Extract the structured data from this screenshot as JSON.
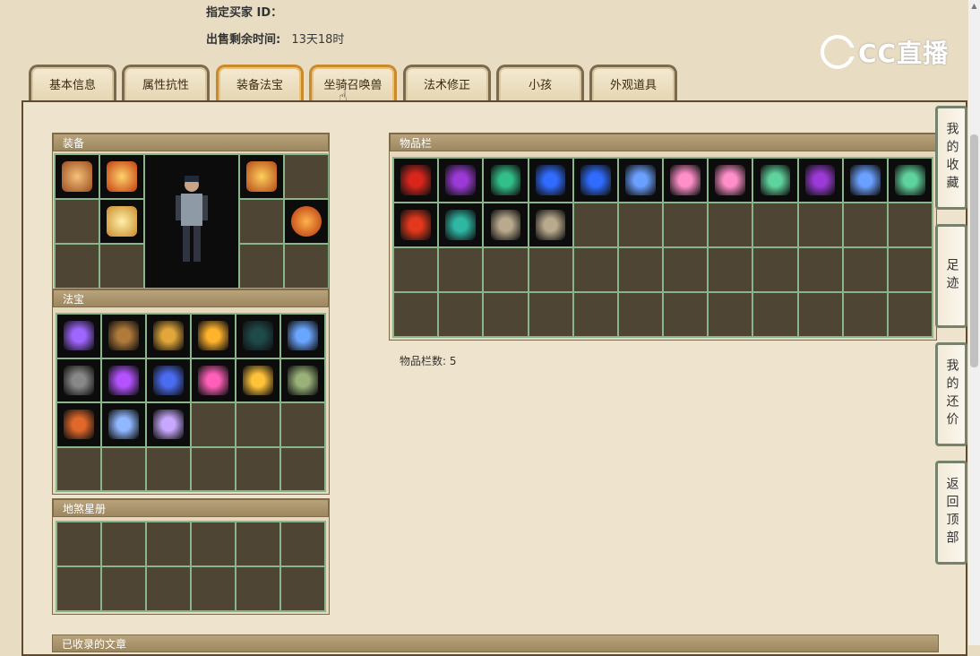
{
  "header": {
    "buyer_label": "指定买家 ID：",
    "buyer_value": "",
    "time_label": "出售剩余时间:",
    "time_value": "13天18时"
  },
  "logo": {
    "text": "CC直播",
    "icon": "cc-logo-icon"
  },
  "tabs": [
    {
      "label": "基本信息",
      "active": false
    },
    {
      "label": "属性抗性",
      "active": false
    },
    {
      "label": "装备法宝",
      "active": true
    },
    {
      "label": "坐骑召唤兽",
      "active": true
    },
    {
      "label": "法术修正",
      "active": false
    },
    {
      "label": "小孩",
      "active": false
    },
    {
      "label": "外观道具",
      "active": false
    }
  ],
  "equipment": {
    "title": "装备",
    "slots": [
      "hat-item",
      "crown-item",
      "robe-item",
      "necklace-item",
      "amulet-item"
    ]
  },
  "treasures": {
    "title": "法宝",
    "items": [
      "purple-lantern",
      "bronze-tablet",
      "golden-lute",
      "fire-pagoda",
      "dark-orb",
      "ice-gauntlet",
      "grey-claw",
      "purple-whip",
      "blue-book",
      "pink-lantern",
      "gold-phoenix",
      "jade-seal",
      "red-book",
      "frost-talon",
      "spirit-ribbon"
    ]
  },
  "star_book": {
    "title": "地煞星册"
  },
  "inventory": {
    "title": "物品栏",
    "items": [
      "red-gem",
      "purple-crystal",
      "green-drop",
      "blue-orb",
      "blue-orb",
      "blue-crystal",
      "pink-heart",
      "pink-heart",
      "green-tablet",
      "purple-crystal",
      "blue-crystal",
      "green-tablet",
      "red-orb",
      "teal-orb",
      "hero-card",
      "hero-card"
    ],
    "count_label": "物品栏数:",
    "count_value": "5"
  },
  "right_nav": [
    {
      "label": "我的收藏"
    },
    {
      "label": "足迹"
    },
    {
      "label": "我的还价"
    },
    {
      "label": "返回顶部"
    }
  ],
  "bottom": {
    "title": "已收录的文章"
  },
  "colors": {
    "panel": "#eee3cc",
    "grid_bg": "#4e4535",
    "grid_line": "#8ab48a",
    "tab_border": "#7b6a4c"
  }
}
